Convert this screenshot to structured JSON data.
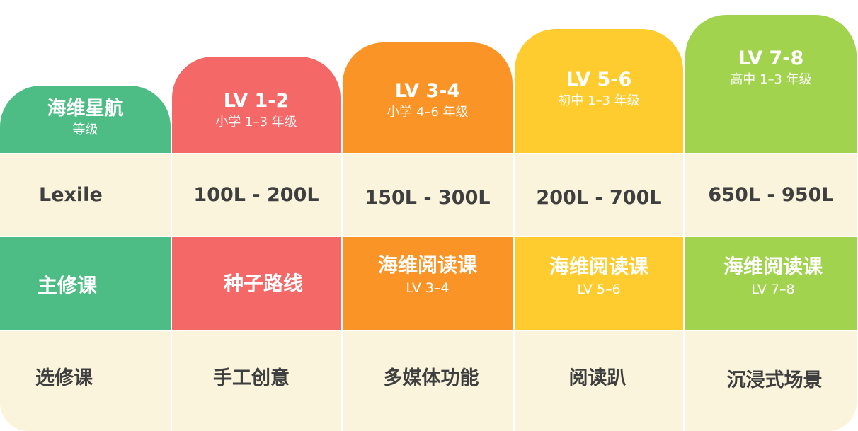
{
  "colors": {
    "green": "#4dbd85",
    "red": "#f46868",
    "orange": "#fb9426",
    "yellow": "#fecc2f",
    "lime": "#a1d34e",
    "cream": "#faf4dc"
  },
  "header": [
    {
      "title": "海维星航",
      "subtitle": "等级"
    },
    {
      "title": "LV 1-2",
      "subtitle": "小学 1–3 年级"
    },
    {
      "title": "LV 3-4",
      "subtitle": "小学 4–6 年级"
    },
    {
      "title": "LV 5-6",
      "subtitle": "初中 1–3 年级"
    },
    {
      "title": "LV 7-8",
      "subtitle": "高中 1–3 年级"
    }
  ],
  "lexile": [
    "Lexile",
    "100L - 200L",
    "150L - 300L",
    "200L - 700L",
    "650L - 950L"
  ],
  "main_course": [
    {
      "title": "主修课",
      "sub": ""
    },
    {
      "title": "种子路线",
      "sub": ""
    },
    {
      "title": "海维阅读课",
      "sub": "LV 3–4"
    },
    {
      "title": "海维阅读课",
      "sub": "LV 5–6"
    },
    {
      "title": "海维阅读课",
      "sub": "LV 7–8"
    }
  ],
  "elective": [
    "选修课",
    "手工创意",
    "多媒体功能",
    "阅读趴",
    "沉浸式场景"
  ]
}
